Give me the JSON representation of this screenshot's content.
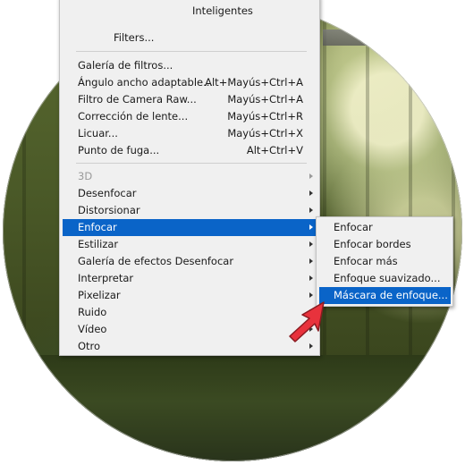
{
  "menu": {
    "top_partial_1": "Inteligentes",
    "top_partial_2": "Filters...",
    "items": [
      {
        "label": "Galería de filtros...",
        "shortcut": ""
      },
      {
        "label": "Ángulo ancho adaptable...",
        "shortcut": "Alt+Mayús+Ctrl+A"
      },
      {
        "label": "Filtro de Camera Raw...",
        "shortcut": "Mayús+Ctrl+A"
      },
      {
        "label": "Corrección de lente...",
        "shortcut": "Mayús+Ctrl+R"
      },
      {
        "label": "Licuar...",
        "shortcut": "Mayús+Ctrl+X"
      },
      {
        "label": "Punto de fuga...",
        "shortcut": "Alt+Ctrl+V"
      }
    ],
    "submenus": [
      {
        "label": "3D"
      },
      {
        "label": "Desenfocar"
      },
      {
        "label": "Distorsionar"
      },
      {
        "label": "Enfocar"
      },
      {
        "label": "Estilizar"
      },
      {
        "label": "Galería de efectos Desenfocar"
      },
      {
        "label": "Interpretar"
      },
      {
        "label": "Pixelizar"
      },
      {
        "label": "Ruido"
      },
      {
        "label": "Vídeo"
      },
      {
        "label": "Otro"
      }
    ]
  },
  "submenu_enfocar": {
    "items": [
      {
        "label": "Enfocar"
      },
      {
        "label": "Enfocar bordes"
      },
      {
        "label": "Enfocar más"
      },
      {
        "label": "Enfoque suavizado..."
      },
      {
        "label": "Máscara de enfoque..."
      }
    ]
  },
  "colors": {
    "menu_bg": "#f0f0f0",
    "highlight": "#0a64c8",
    "cursor": "#e8323c"
  }
}
